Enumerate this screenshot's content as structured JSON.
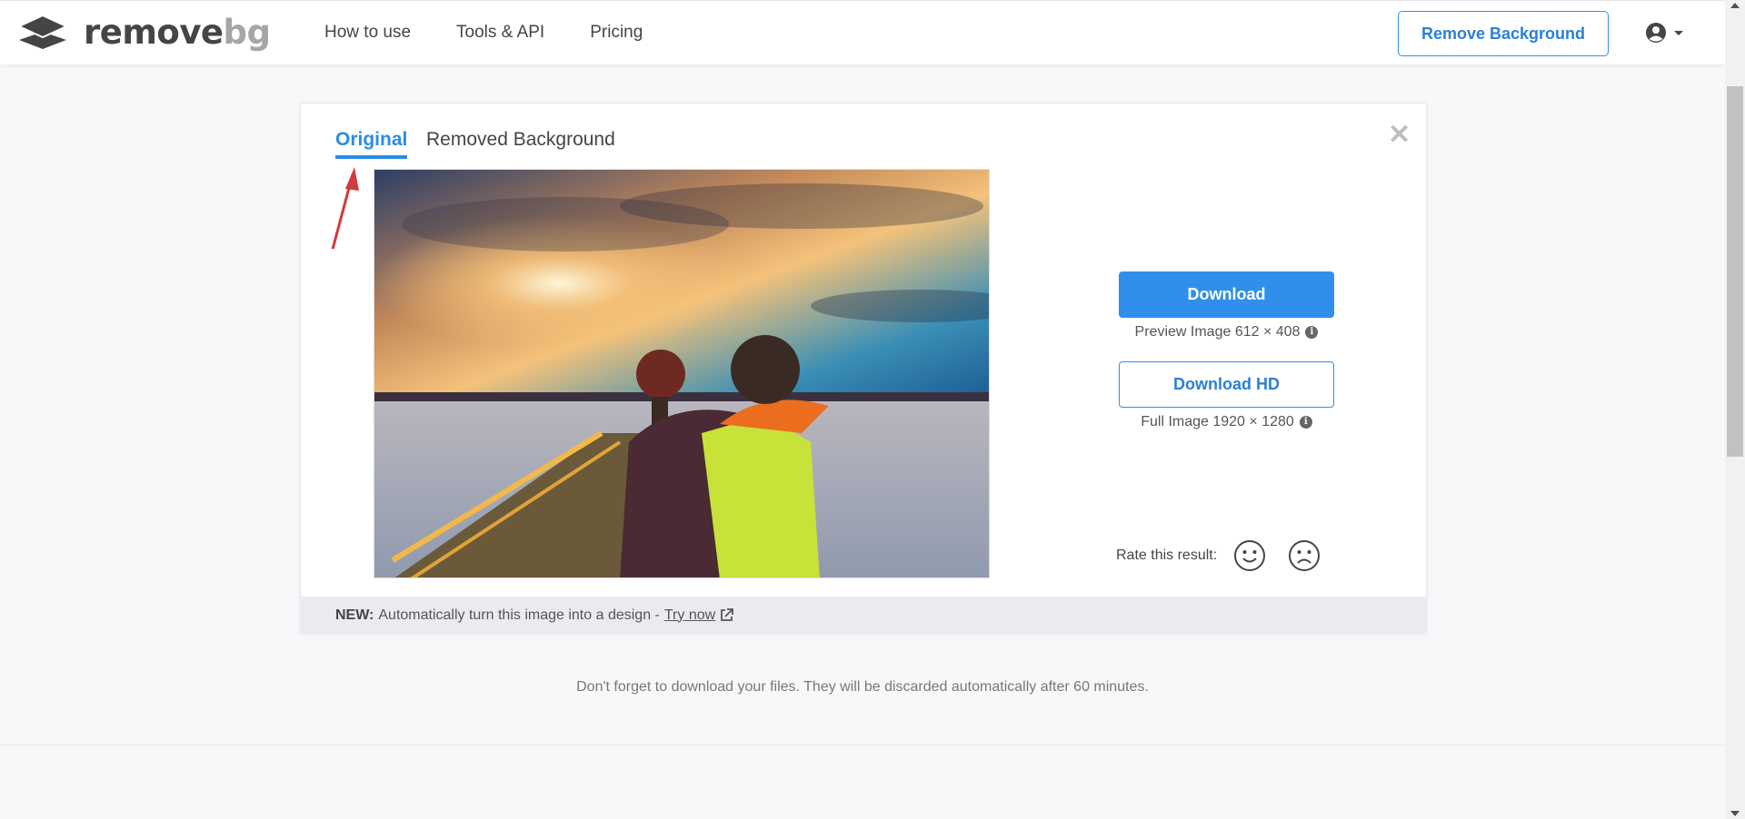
{
  "header": {
    "logo_remove": "remove",
    "logo_bg": "bg",
    "nav": [
      {
        "label": "How to use"
      },
      {
        "label": "Tools & API"
      },
      {
        "label": "Pricing"
      }
    ],
    "remove_background_button": "Remove Background"
  },
  "card": {
    "tabs": [
      {
        "label": "Original",
        "active": true
      },
      {
        "label": "Removed Background",
        "active": false
      }
    ],
    "close_label": "✕",
    "download_button": "Download",
    "preview_info": "Preview Image 612 × 408",
    "download_hd_button": "Download HD",
    "full_info": "Full Image 1920 × 1280",
    "info_glyph": "i",
    "rate_label": "Rate this result:",
    "footer": {
      "new_label": "NEW:",
      "text": "Automatically turn this image into a design -",
      "link": "Try now"
    }
  },
  "notice": "Don't forget to download your files. They will be discarded automatically after 60 minutes.",
  "colors": {
    "accent": "#2f8fea",
    "annotation_arrow": "#d23b3b"
  }
}
